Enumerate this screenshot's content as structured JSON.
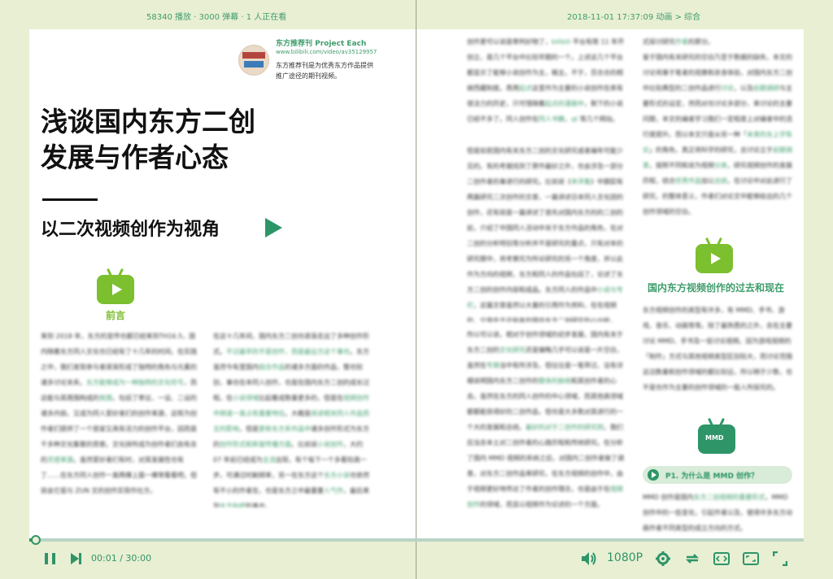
{
  "top_bar": {
    "stats": "58340 播放 · 3000 弹幕 · 1 人正在看",
    "meta": "2018-11-01 17:37:09    动画 > 综合"
  },
  "recommend": {
    "title": "东方推荐刊 Project Each",
    "url": "www.bilibili.com/video/av35129957",
    "desc": "东方推荐刊是为优秀东方作品提供推广途径的期刊视频。"
  },
  "article": {
    "title_line1": "浅谈国内东方二创",
    "title_line2": "发展与作者心态",
    "subtitle": "以二次视频创作为视角",
    "section_intro": "前言",
    "section_history": "国内东方视频创作的过去和现在",
    "section_mmd": "MMD",
    "subsection_mmd": "P1. 为什么是 MMD 创作？"
  },
  "player": {
    "current_time": "00:01",
    "separator": "/",
    "total_time": "30:00",
    "resolution": "1080P",
    "progress_fraction": 0.0006
  },
  "colors": {
    "accent": "#2e9568",
    "page_bg": "#e9efd3",
    "badge": "#7cbf2f"
  },
  "icons": [
    "pause-icon",
    "next-icon",
    "volume-icon",
    "settings-icon",
    "loop-icon",
    "widescreen-icon",
    "webfullscreen-icon",
    "fullscreen-icon"
  ]
}
